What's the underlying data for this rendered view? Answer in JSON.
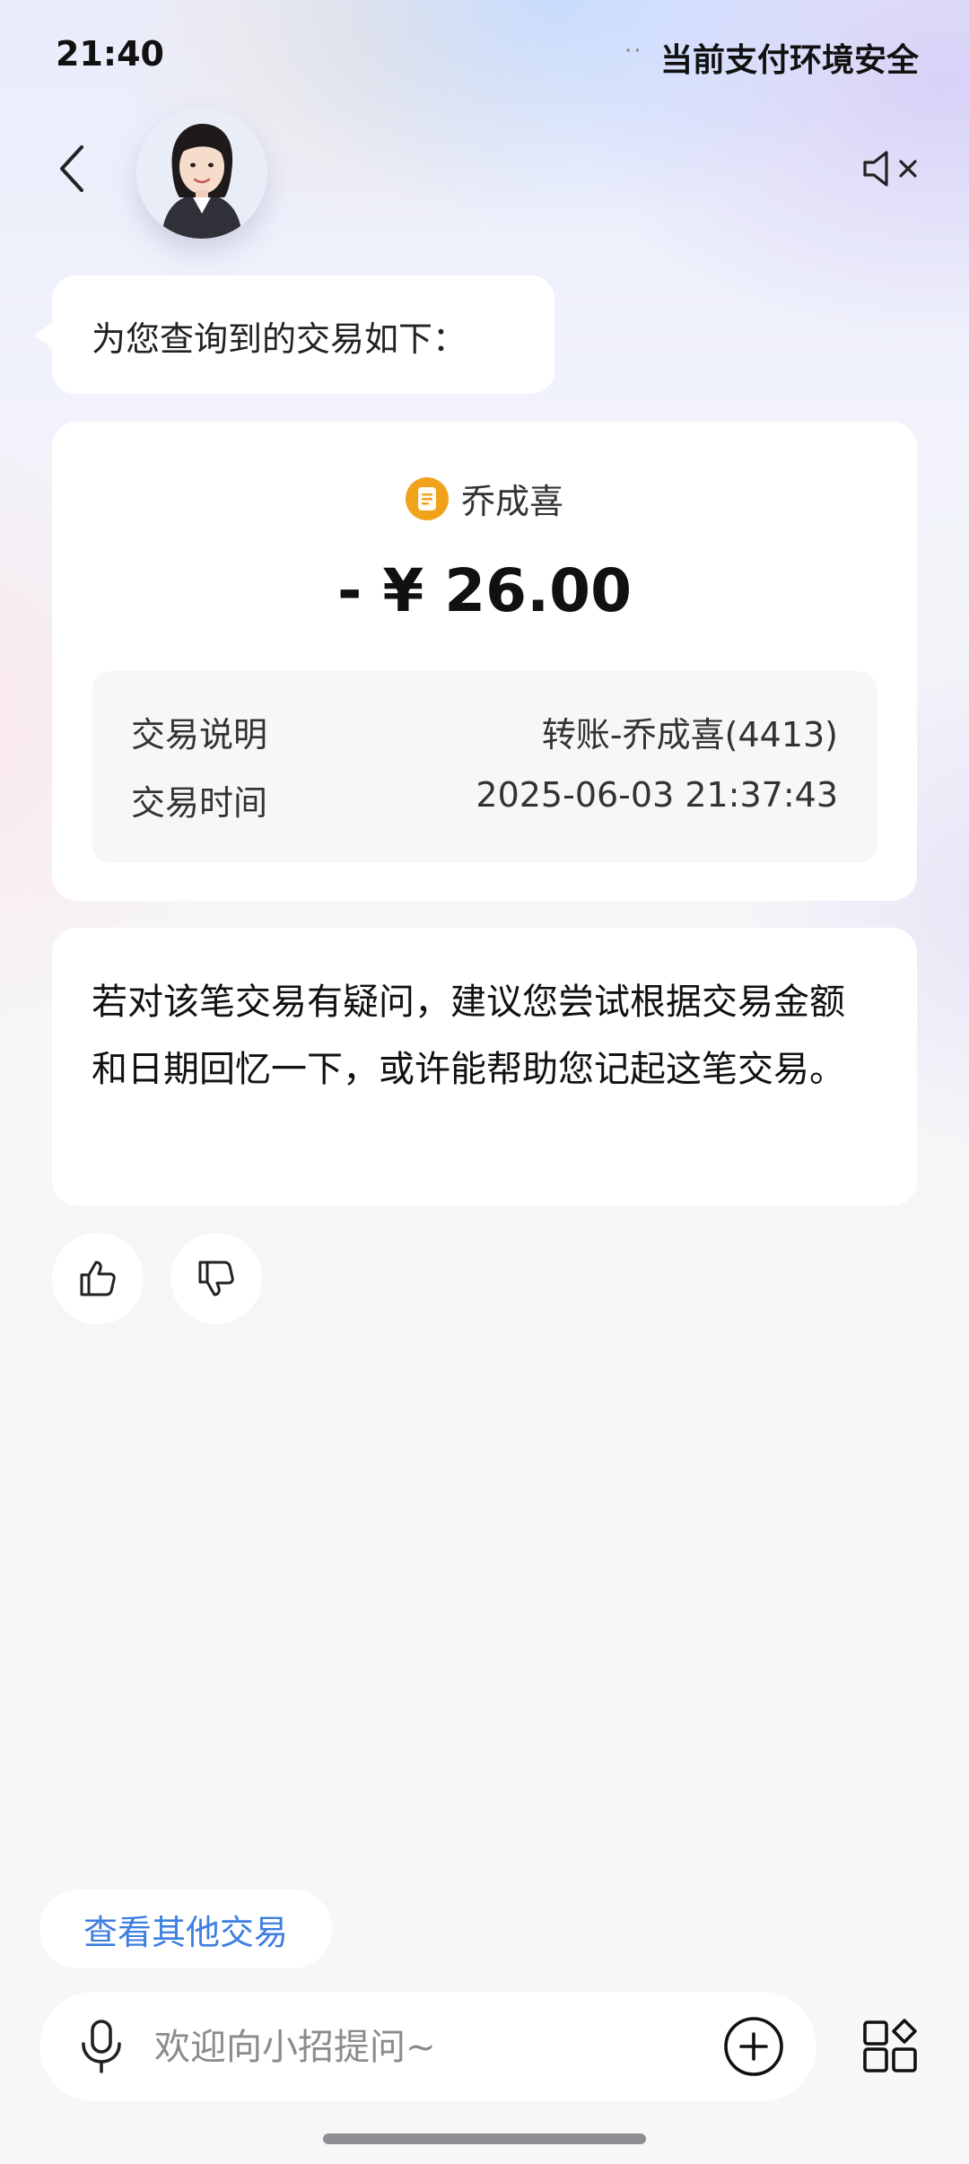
{
  "status_bar": {
    "time": "21:40",
    "dots": "··",
    "safety_text": "当前支付环境安全"
  },
  "header": {
    "back_icon": "chevron-left-icon",
    "avatar": "assistant-avatar",
    "mute_icon": "speaker-muted-icon"
  },
  "chat": {
    "bubble_text": "为您查询到的交易如下："
  },
  "transaction": {
    "payee_icon": "document-icon",
    "payee_name": "乔成喜",
    "amount": "- ¥ 26.00",
    "rows": [
      {
        "label": "交易说明",
        "value": "转账-乔成喜(4413)"
      },
      {
        "label": "交易时间",
        "value": "2025-06-03 21:37:43"
      }
    ]
  },
  "advice": {
    "text": "若对该笔交易有疑问，建议您尝试根据交易金额和日期回忆一下，或许能帮助您记起这笔交易。"
  },
  "feedback": {
    "like_icon": "thumbs-up-icon",
    "dislike_icon": "thumbs-down-icon"
  },
  "suggestion": {
    "label": "查看其他交易"
  },
  "input_bar": {
    "placeholder": "欢迎向小招提问~",
    "value": "",
    "mic_icon": "microphone-icon",
    "plus_icon": "plus-circle-icon",
    "apps_icon": "apps-grid-icon"
  },
  "colors": {
    "accent": "#3d7fe0",
    "payee_icon_bg": "#f0a21b",
    "card_bg": "#ffffff"
  }
}
